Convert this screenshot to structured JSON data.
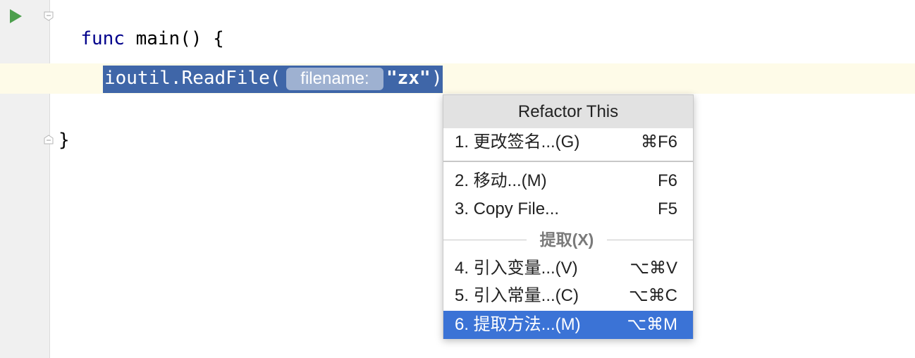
{
  "editor": {
    "line1_keyword": "func",
    "line1_rest": " main() {",
    "selected_call": "ioutil.ReadFile(",
    "param_hint": "filename:",
    "string_arg": "\"zx\"",
    "close_paren": ")",
    "closing_brace": "}"
  },
  "popup": {
    "title": "Refactor This",
    "items": [
      {
        "label": "1. 更改签名...(G)",
        "shortcut": "⌘F6"
      },
      {
        "label": "2. 移动...(M)",
        "shortcut": "F6"
      },
      {
        "label": "3. Copy File...",
        "shortcut": "F5"
      },
      {
        "label": "4. 引入变量...(V)",
        "shortcut": "⌥⌘V"
      },
      {
        "label": "5. 引入常量...(C)",
        "shortcut": "⌥⌘C"
      },
      {
        "label": "6. 提取方法...(M)",
        "shortcut": "⌥⌘M"
      }
    ],
    "group_title": "提取(X)"
  },
  "colors": {
    "selection": "#3f66a8",
    "menu_selected": "#3b73d6",
    "keyword": "#00008b",
    "run_icon": "#4c9f4c"
  },
  "icons": [
    "run-icon",
    "fold-icon"
  ]
}
